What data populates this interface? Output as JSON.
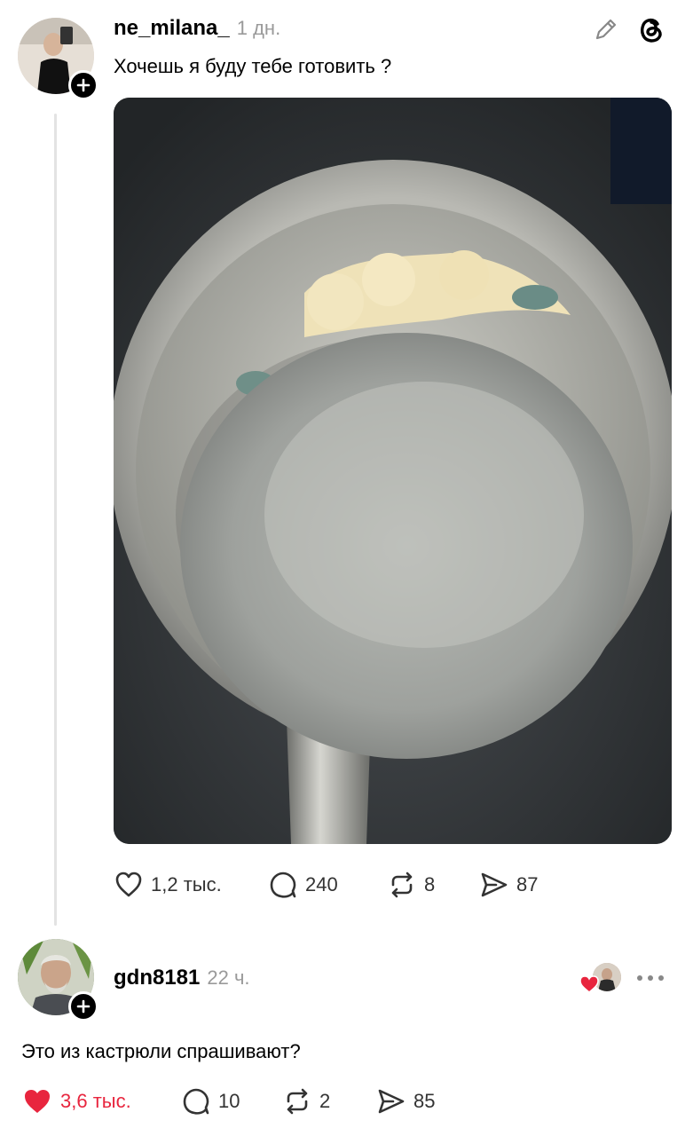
{
  "post": {
    "username": "ne_milana_",
    "time": "1 дн.",
    "text": "Хочешь я буду тебе готовить ?",
    "likes": "1,2 тыс.",
    "comments": "240",
    "reposts": "8",
    "shares": "87"
  },
  "reply": {
    "username": "gdn8181",
    "time": "22 ч.",
    "text": "Это из кастрюли спрашивают?",
    "likes": "3,6 тыс.",
    "comments": "10",
    "reposts": "2",
    "shares": "85"
  },
  "colors": {
    "like_active": "#e8253e",
    "muted": "#9a9a9a"
  },
  "icons": [
    "edit-icon",
    "threads-logo-icon",
    "heart-icon",
    "comment-icon",
    "repost-icon",
    "share-icon",
    "more-icon",
    "plus-icon"
  ]
}
